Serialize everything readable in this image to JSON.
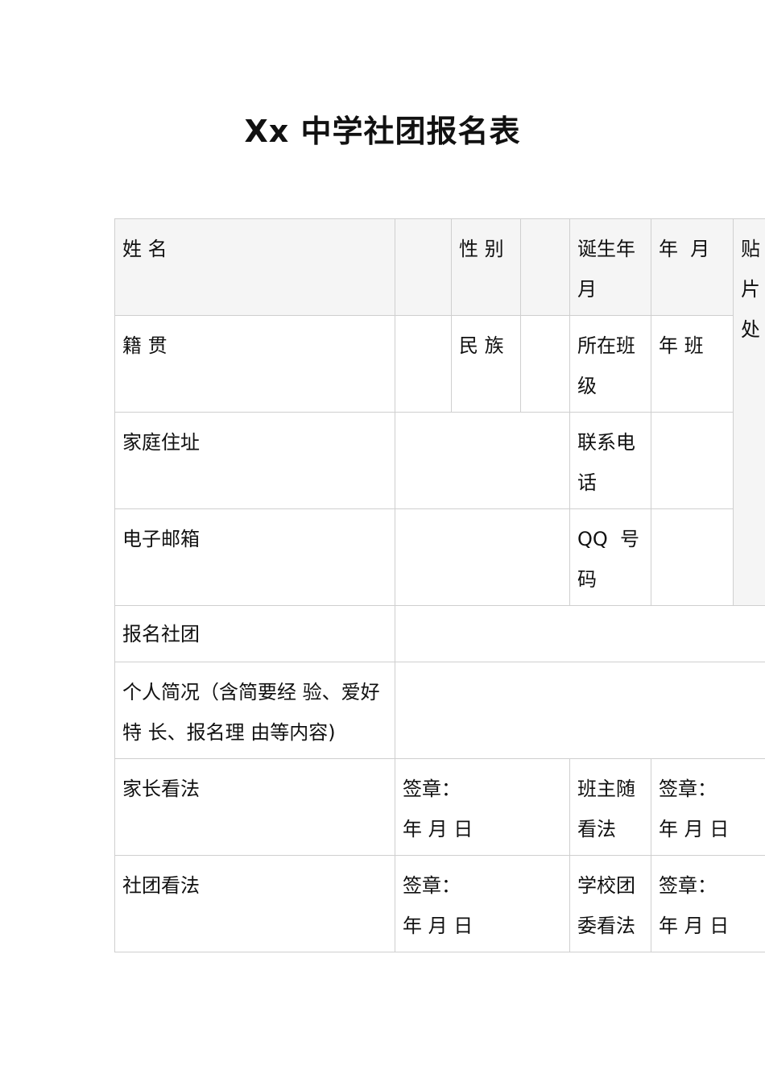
{
  "title": "Xx 中学社团报名表",
  "form": {
    "name_label": "姓 名",
    "gender_label": "性 别",
    "birth_label": "诞生年月",
    "birth_value": "年  月",
    "photo_label": "贴片处",
    "native_label": "籍 贯",
    "ethnic_label": "民 族",
    "class_label": "所在班级",
    "class_value": "年 班",
    "address_label": "家庭住址",
    "phone_label": "联系电话",
    "email_label": "电子邮箱",
    "qq_label": "QQ  号码",
    "club_label": "报名社团",
    "profile_label": "个人简况（含简要经 验、爱好特 长、报名理 由等内容)",
    "parent_label": "家长看法",
    "parent_sign": "签章：",
    "parent_date": "年 月 日",
    "teacher_label": "班主随看法",
    "teacher_sign": "签章：",
    "teacher_date": "年 月 日",
    "club_opinion_label": "社团看法",
    "club_sign": "签章：",
    "club_date": "年 月 日",
    "league_label": "学校团委看法",
    "league_sign": "签章：",
    "league_date": "年 月 日"
  }
}
